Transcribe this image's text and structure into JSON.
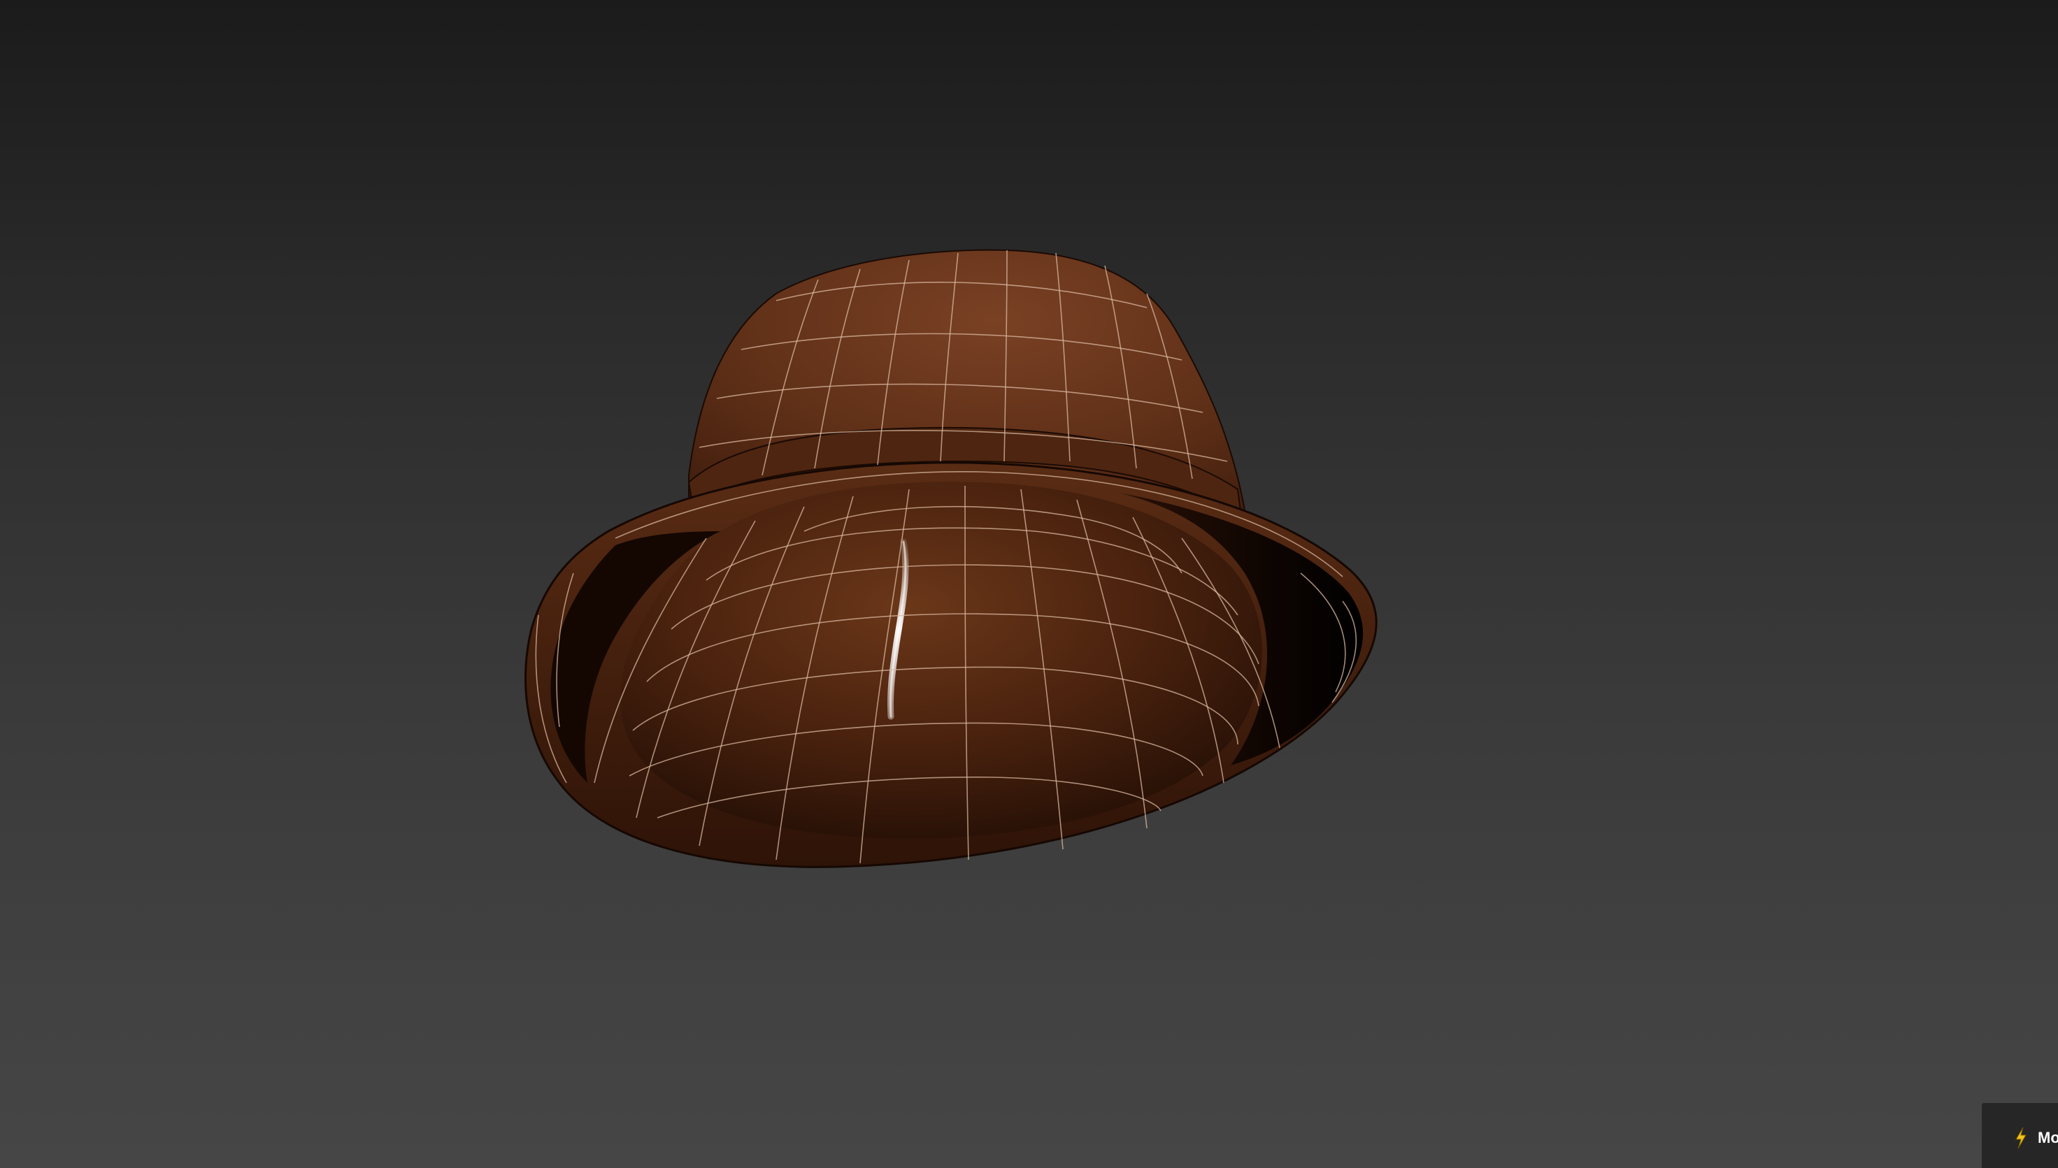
{
  "viewport": {
    "background_top": "#1b1b1b",
    "background_bottom": "#464646",
    "object": "hat-model",
    "material_color": "#5a2d14",
    "wireframe_color": "#d9b8a0"
  },
  "badge": {
    "icon": "lightning-bolt-icon",
    "label": "Mo"
  }
}
